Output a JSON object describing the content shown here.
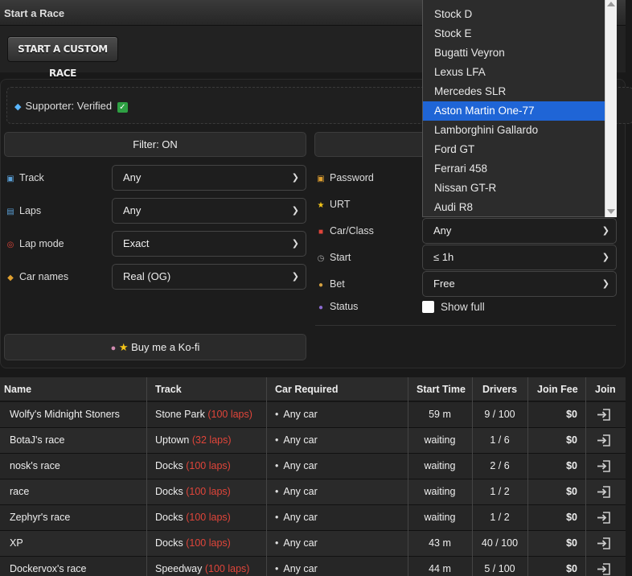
{
  "header": {
    "title": "Start a Race",
    "custom_race_button": "START A CUSTOM RACE"
  },
  "supporter": {
    "text": "Supporter: Verified"
  },
  "filter_button": "Filter: ON",
  "filters_left": [
    {
      "label": "Track",
      "value": "Any",
      "icon": "map-icon"
    },
    {
      "label": "Laps",
      "value": "Any",
      "icon": "laps-icon"
    },
    {
      "label": "Lap mode",
      "value": "Exact",
      "icon": "target-icon"
    },
    {
      "label": "Car names",
      "value": "Real (OG)",
      "icon": "tag-icon"
    }
  ],
  "filters_right": [
    {
      "label": "Password",
      "icon": "lock-icon"
    },
    {
      "label": "URT",
      "icon": "star-icon"
    },
    {
      "label": "Car/Class",
      "value": "Any",
      "icon": "car-icon"
    },
    {
      "label": "Start",
      "value": "≤ 1h",
      "icon": "clock-icon"
    },
    {
      "label": "Bet",
      "value": "Free",
      "icon": "money-bag-icon"
    },
    {
      "label": "Status",
      "icon": "people-icon",
      "checkbox_label": "Show full",
      "checked": false
    }
  ],
  "kofi_button": "Buy me a Ko-fi",
  "car_dropdown": {
    "options": [
      "Stock D",
      "Stock E",
      "Bugatti Veyron",
      "Lexus LFA",
      "Mercedes SLR",
      "Aston Martin One-77",
      "Lamborghini Gallardo",
      "Ford GT",
      "Ferrari 458",
      "Nissan GT-R",
      "Audi R8"
    ],
    "highlighted": "Aston Martin One-77"
  },
  "table": {
    "headers": [
      "Name",
      "Track",
      "Car Required",
      "Start Time",
      "Drivers",
      "Join Fee",
      "Join"
    ],
    "rows": [
      {
        "name": "Wolfy's Midnight Stoners",
        "track": "Stone Park",
        "laps": "(100 laps)",
        "car": "Any car",
        "start": "59 m",
        "drivers": "9 / 100",
        "fee": "$0"
      },
      {
        "name": "BotaJ's race",
        "track": "Uptown",
        "laps": "(32 laps)",
        "car": "Any car",
        "start": "waiting",
        "drivers": "1 / 6",
        "fee": "$0"
      },
      {
        "name": "nosk's race",
        "track": "Docks",
        "laps": "(100 laps)",
        "car": "Any car",
        "start": "waiting",
        "drivers": "2 / 6",
        "fee": "$0"
      },
      {
        "name": "race",
        "track": "Docks",
        "laps": "(100 laps)",
        "car": "Any car",
        "start": "waiting",
        "drivers": "1 / 2",
        "fee": "$0"
      },
      {
        "name": "Zephyr's race",
        "track": "Docks",
        "laps": "(100 laps)",
        "car": "Any car",
        "start": "waiting",
        "drivers": "1 / 2",
        "fee": "$0"
      },
      {
        "name": "XP",
        "track": "Docks",
        "laps": "(100 laps)",
        "car": "Any car",
        "start": "43 m",
        "drivers": "40 / 100",
        "fee": "$0"
      },
      {
        "name": "Dockervox's race",
        "track": "Speedway",
        "laps": "(100 laps)",
        "car": "Any car",
        "start": "44 m",
        "drivers": "5 / 100",
        "fee": "$0"
      }
    ]
  },
  "colors": {
    "laps": "#e0453a",
    "highlight": "#1f65d6",
    "check": "#2ea043"
  }
}
